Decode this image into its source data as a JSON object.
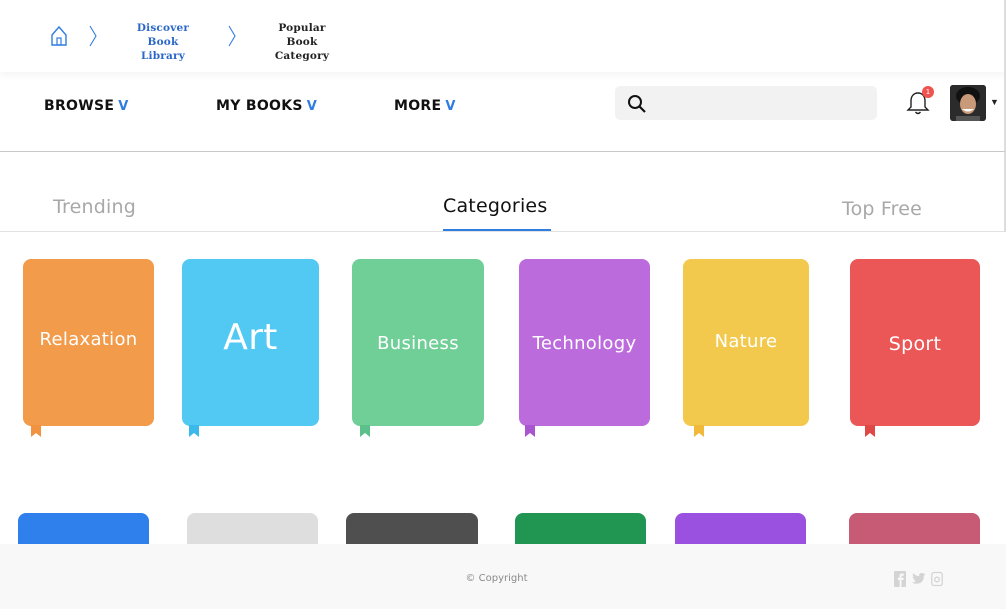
{
  "breadcrumb": {
    "home_icon": "home-icon",
    "link_line1": "Discover Book",
    "link_line2": "Library",
    "current_line1": "Popular Book",
    "current_line2": "Category"
  },
  "nav": {
    "items": [
      {
        "label": "BROWSE",
        "arrow": "V"
      },
      {
        "label": "MY BOOKS",
        "arrow": "V"
      },
      {
        "label": "MORE",
        "arrow": "V"
      }
    ],
    "search_placeholder": "",
    "notification_count": "1",
    "accent": "#2f7de1"
  },
  "tabs": [
    {
      "label": "Trending",
      "active": false
    },
    {
      "label": "Categories",
      "active": true
    },
    {
      "label": "Top Free",
      "active": false
    }
  ],
  "categories": [
    {
      "label": "Relaxation",
      "color": "#f29b4b",
      "ribbon": "#f0923f"
    },
    {
      "label": "Art",
      "color": "#52c9f2",
      "ribbon": "#3bb9ea"
    },
    {
      "label": "Business",
      "color": "#6fcf97",
      "ribbon": "#5cc08a"
    },
    {
      "label": "Technology",
      "color": "#bb6bdc",
      "ribbon": "#a955d0"
    },
    {
      "label": "Nature",
      "color": "#f2c94c",
      "ribbon": "#f0b93a"
    },
    {
      "label": "Sport",
      "color": "#eb5757",
      "ribbon": "#e04848"
    }
  ],
  "second_row_colors": [
    "#2f80ed",
    "#dedede",
    "#4f4f4f",
    "#219653",
    "#9b51e0",
    "#c75b75"
  ],
  "footer": {
    "copyright": "© Copyright",
    "social": [
      "facebook-icon",
      "twitter-icon",
      "instagram-icon"
    ]
  }
}
